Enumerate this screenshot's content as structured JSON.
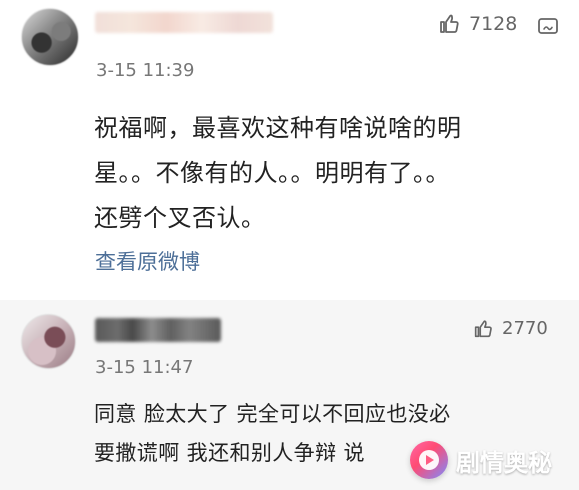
{
  "comments": [
    {
      "time": "3-15 11:39",
      "likes": "7128",
      "text_lines": [
        "祝福啊，最喜欢这种有啥说啥的明",
        "星。。不像有的人。。明明有了。。",
        "还劈个叉否认。"
      ],
      "link": "查看原微博"
    },
    {
      "time": "3-15 11:47",
      "likes": "2770",
      "text_lines": [
        "同意 脸太大了 完全可以不回应也没必",
        "要撒谎啊 我还和别人争辩 说"
      ]
    }
  ],
  "watermark": {
    "label": "剧情奥秘",
    "icon": "play-logo-icon"
  },
  "icons": {
    "like": "thumbs-up-icon",
    "more": "more-icon"
  },
  "colors": {
    "main_bg": "#ffffff",
    "sub_bg": "#f6f6f6",
    "link": "#4d6f98",
    "meta": "#777777"
  }
}
